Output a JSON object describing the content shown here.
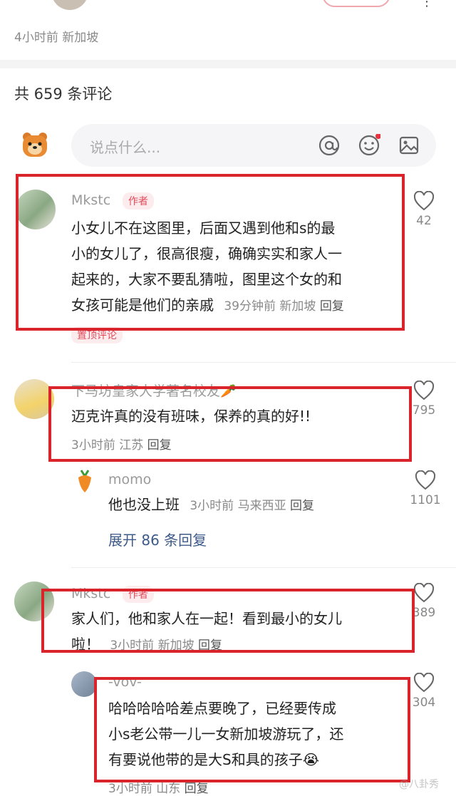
{
  "post": {
    "time_loc": "4小时前 新加坡",
    "comment_total": "共 659 条评论"
  },
  "input": {
    "placeholder": "说点什么..."
  },
  "comments": [
    {
      "user": "Mkstc",
      "tag": "作者",
      "text_lines": [
        "小女儿不在这图里，后面又遇到他和s的最",
        "小的女儿了，很高很瘦，确确实实和家人一",
        "起来的，大家不要乱猜啦，图里这个女的和",
        "女孩可能是他们的亲戚"
      ],
      "time": "39分钟前",
      "loc": "新加坡",
      "reply_label": "回复",
      "likes": "42",
      "pinned": "置顶评论"
    },
    {
      "user": "下马坊皇家大学著名校友🥕",
      "text": "迈克许真的没有班味，保养的真的好!!",
      "time": "3小时前",
      "loc": "江苏",
      "reply_label": "回复",
      "likes": "795",
      "reply": {
        "user": "momo",
        "text": "他也没上班",
        "time": "3小时前",
        "loc": "马来西亚",
        "reply_label": "回复",
        "likes": "1101"
      },
      "expand": "展开 86 条回复"
    },
    {
      "user": "Mkstc",
      "tag": "作者",
      "text_lines": [
        "家人们，他和家人在一起！看到最小的女儿",
        "啦！"
      ],
      "time": "3小时前",
      "loc": "新加坡",
      "reply_label": "回复",
      "likes": "389",
      "reply": {
        "user": "-vov-",
        "text_lines": [
          "哈哈哈哈哈差点要晚了，已经要传成",
          "小s老公带一儿一女新加坡游玩了，还",
          "有要说他带的是大S和具的孩子😭"
        ],
        "time": "3小时前",
        "loc": "山东",
        "reply_label": "回复",
        "likes": "304"
      }
    }
  ],
  "watermark": "@八卦秀"
}
